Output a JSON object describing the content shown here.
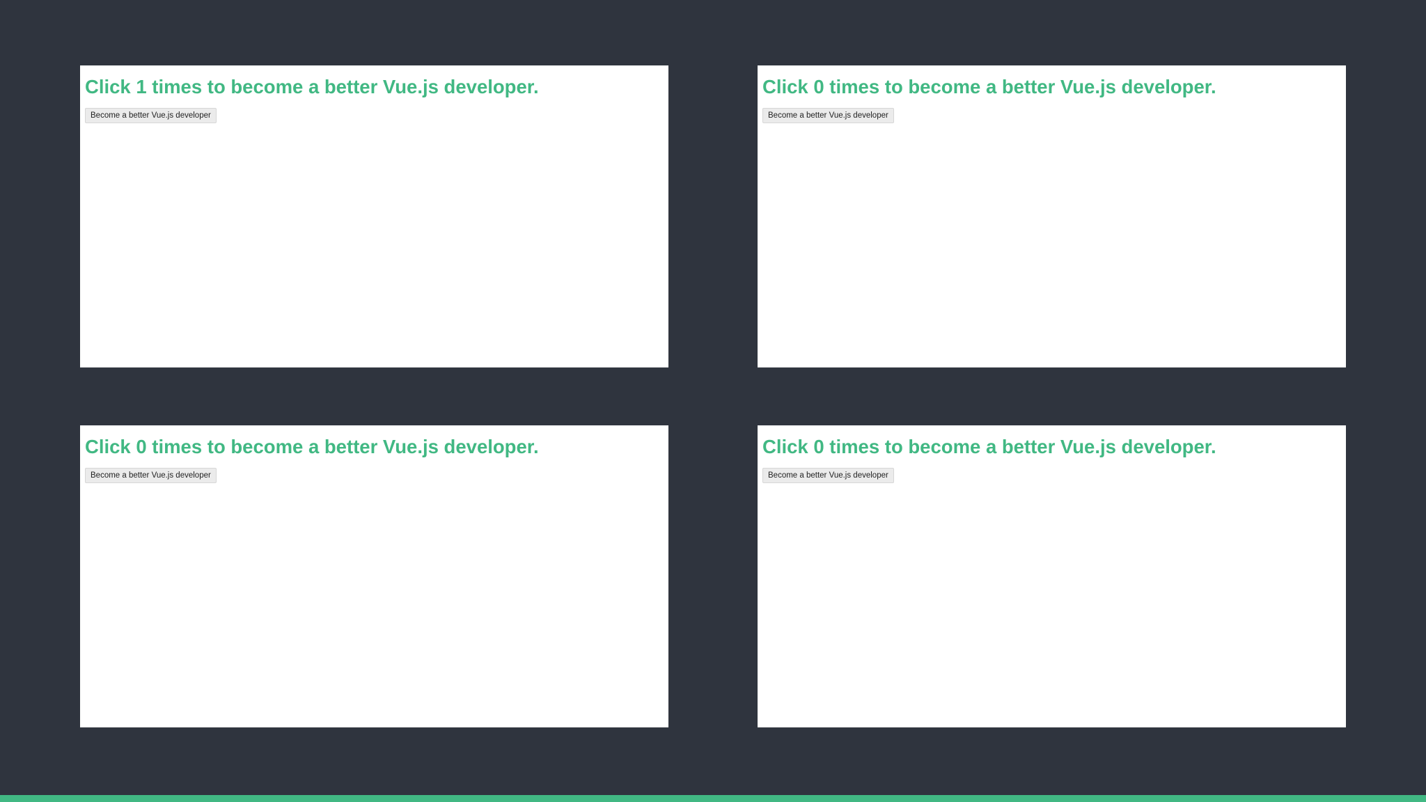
{
  "colors": {
    "background": "#2f343e",
    "heading": "#41b883",
    "accent_bar": "#41b883",
    "panel": "#ffffff"
  },
  "panels": [
    {
      "heading": "Click 1 times to become a better Vue.js developer.",
      "button_label": "Become a better Vue.js developer"
    },
    {
      "heading": "Click 0 times to become a better Vue.js developer.",
      "button_label": "Become a better Vue.js developer"
    },
    {
      "heading": "Click 0 times to become a better Vue.js developer.",
      "button_label": "Become a better Vue.js developer"
    },
    {
      "heading": "Click 0 times to become a better Vue.js developer.",
      "button_label": "Become a better Vue.js developer"
    }
  ]
}
